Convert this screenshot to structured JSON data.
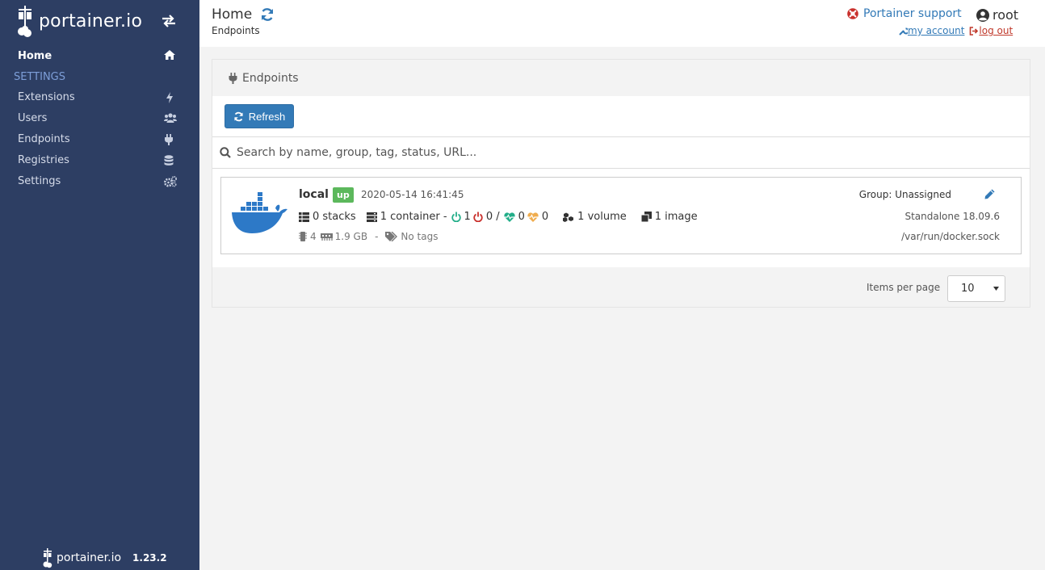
{
  "brand": {
    "name": "portainer.io",
    "version": "1.23.2"
  },
  "sidebar": {
    "home_label": "Home",
    "section_title": "SETTINGS",
    "items": [
      {
        "label": "Extensions",
        "icon": "bolt-icon"
      },
      {
        "label": "Users",
        "icon": "users-icon"
      },
      {
        "label": "Endpoints",
        "icon": "plug-icon"
      },
      {
        "label": "Registries",
        "icon": "database-icon"
      },
      {
        "label": "Settings",
        "icon": "cogs-icon"
      }
    ]
  },
  "header": {
    "title": "Home",
    "breadcrumb": "Endpoints",
    "support_label": "Portainer support",
    "username": "root",
    "my_account_label": " my account ",
    "logout_label": " log out"
  },
  "endpoints_widget": {
    "title": "Endpoints",
    "refresh_label": "Refresh",
    "search_placeholder": "Search by name, group, tag, status, URL...",
    "items_per_page_label": "Items per page",
    "items_per_page_value": "10"
  },
  "endpoint": {
    "name": "local",
    "status": "up",
    "date": "2020-05-14 16:41:45",
    "stacks": "0 stacks",
    "containers": "1 container -",
    "running": "1",
    "stopped": "0 /",
    "healthy": "0",
    "unhealthy": "0",
    "volumes": "1 volume",
    "images": "1 image",
    "cpu": "4",
    "memory": "1.9 GB",
    "separator": "-",
    "tags": "No tags",
    "group": "Group: Unassigned",
    "version": "Standalone 18.09.6",
    "url": "/var/run/docker.sock"
  },
  "colors": {
    "sidebar_bg": "#2d3e63",
    "primary": "#337ab7",
    "success": "#5cb85c",
    "danger": "#c9302c",
    "healthy": "#23ae89",
    "warning": "#f0ad4e"
  }
}
